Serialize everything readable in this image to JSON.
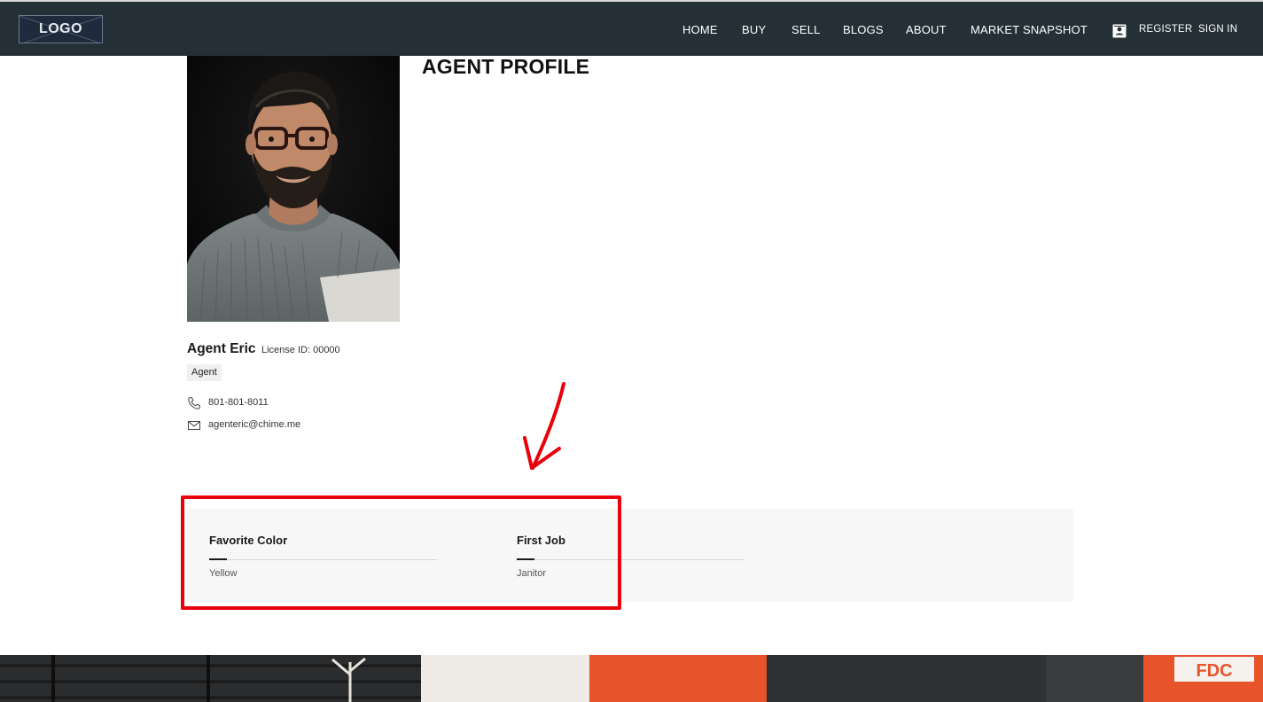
{
  "header": {
    "logo_text": "LOGO",
    "nav": [
      "HOME",
      "BUY",
      "SELL",
      "BLOGS",
      "ABOUT",
      "MARKET SNAPSHOT"
    ],
    "register_label": "REGISTER",
    "signin_label": "SIGN IN",
    "icons": {
      "register": "contact-card-icon"
    }
  },
  "profile": {
    "page_title": "AGENT PROFILE",
    "name": "Agent Eric",
    "license": "License ID: 00000",
    "role": "Agent",
    "phone": "801-801-8011",
    "email": "agenteric@chime.me",
    "icons": {
      "phone": "phone-icon",
      "email": "mail-icon"
    }
  },
  "qa": [
    {
      "label": "Favorite Color",
      "value": "Yellow"
    },
    {
      "label": "First Job",
      "value": "Janitor"
    }
  ],
  "colors": {
    "header_bg": "#243036",
    "annotation_red": "#e8000b",
    "panel_bg": "#f7f7f7"
  }
}
